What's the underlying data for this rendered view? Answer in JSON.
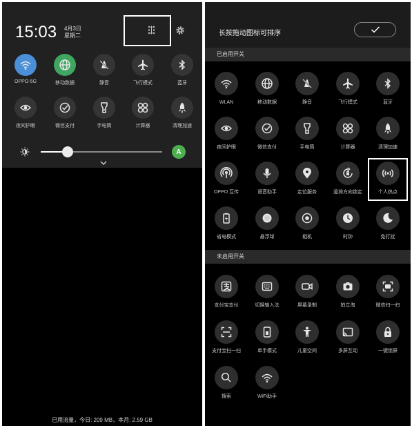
{
  "left": {
    "time": "15:03",
    "date": "4月3日",
    "weekday": "星期二",
    "row1": [
      {
        "label": "OPPO-5G",
        "icon": "wifi-icon",
        "active": true,
        "color": "#4a8fd8"
      },
      {
        "label": "移动数据",
        "icon": "globe-icon",
        "active": true,
        "color": "#3fa560"
      },
      {
        "label": "静音",
        "icon": "mute-icon",
        "active": false
      },
      {
        "label": "飞行模式",
        "icon": "airplane-icon",
        "active": false
      },
      {
        "label": "蓝牙",
        "icon": "bluetooth-icon",
        "active": false
      }
    ],
    "row2": [
      {
        "label": "夜间护眼",
        "icon": "eye-icon"
      },
      {
        "label": "微信支付",
        "icon": "wechat-pay-icon"
      },
      {
        "label": "手电筒",
        "icon": "flashlight-icon"
      },
      {
        "label": "计算器",
        "icon": "calculator-icon"
      },
      {
        "label": "清理加速",
        "icon": "rocket-icon"
      }
    ],
    "brightness_level": 0.22,
    "auto_label": "A",
    "usage_text": "已用流量，今日: 209 MB，本月: 2.59 GB"
  },
  "right": {
    "title": "长按拖动图标可排序",
    "enabled_label": "已启用开关",
    "disabled_label": "未启用开关",
    "enabled_rows": [
      [
        {
          "label": "WLAN",
          "icon": "wifi-icon"
        },
        {
          "label": "移动数据",
          "icon": "globe-icon"
        },
        {
          "label": "静音",
          "icon": "mute-icon"
        },
        {
          "label": "飞行模式",
          "icon": "airplane-icon"
        },
        {
          "label": "蓝牙",
          "icon": "bluetooth-icon"
        }
      ],
      [
        {
          "label": "夜间护眼",
          "icon": "eye-icon"
        },
        {
          "label": "微信支付",
          "icon": "wechat-pay-icon"
        },
        {
          "label": "手电筒",
          "icon": "flashlight-icon"
        },
        {
          "label": "计算器",
          "icon": "calculator-icon"
        },
        {
          "label": "清理加速",
          "icon": "rocket-icon"
        }
      ],
      [
        {
          "label": "OPPO 互传",
          "icon": "share-icon"
        },
        {
          "label": "语音助手",
          "icon": "mic-icon"
        },
        {
          "label": "定位服务",
          "icon": "location-icon"
        },
        {
          "label": "竖排方向锁定",
          "icon": "rotation-lock-icon"
        },
        {
          "label": "个人热点",
          "icon": "hotspot-icon"
        }
      ],
      [
        {
          "label": "省电模式",
          "icon": "battery-icon"
        },
        {
          "label": "悬浮球",
          "icon": "float-ball-icon"
        },
        {
          "label": "相机",
          "icon": "camera-icon"
        },
        {
          "label": "时钟",
          "icon": "clock-icon"
        },
        {
          "label": "免打扰",
          "icon": "moon-icon"
        }
      ]
    ],
    "disabled_rows": [
      [
        {
          "label": "支付宝支付",
          "icon": "alipay-icon"
        },
        {
          "label": "切换输入法",
          "icon": "keyboard-icon"
        },
        {
          "label": "屏幕录制",
          "icon": "video-icon"
        },
        {
          "label": "拍立淘",
          "icon": "camera-square-icon"
        },
        {
          "label": "微信扫一扫",
          "icon": "wechat-scan-icon"
        }
      ],
      [
        {
          "label": "支付宝扫一扫",
          "icon": "scan-icon"
        },
        {
          "label": "单手模式",
          "icon": "one-hand-icon"
        },
        {
          "label": "儿童空间",
          "icon": "child-icon"
        },
        {
          "label": "多屏互动",
          "icon": "cast-icon"
        },
        {
          "label": "一键锁屏",
          "icon": "lock-icon"
        }
      ],
      [
        {
          "label": "搜索",
          "icon": "search-icon"
        },
        {
          "label": "WiFi助手",
          "icon": "wifi-icon"
        }
      ]
    ]
  }
}
